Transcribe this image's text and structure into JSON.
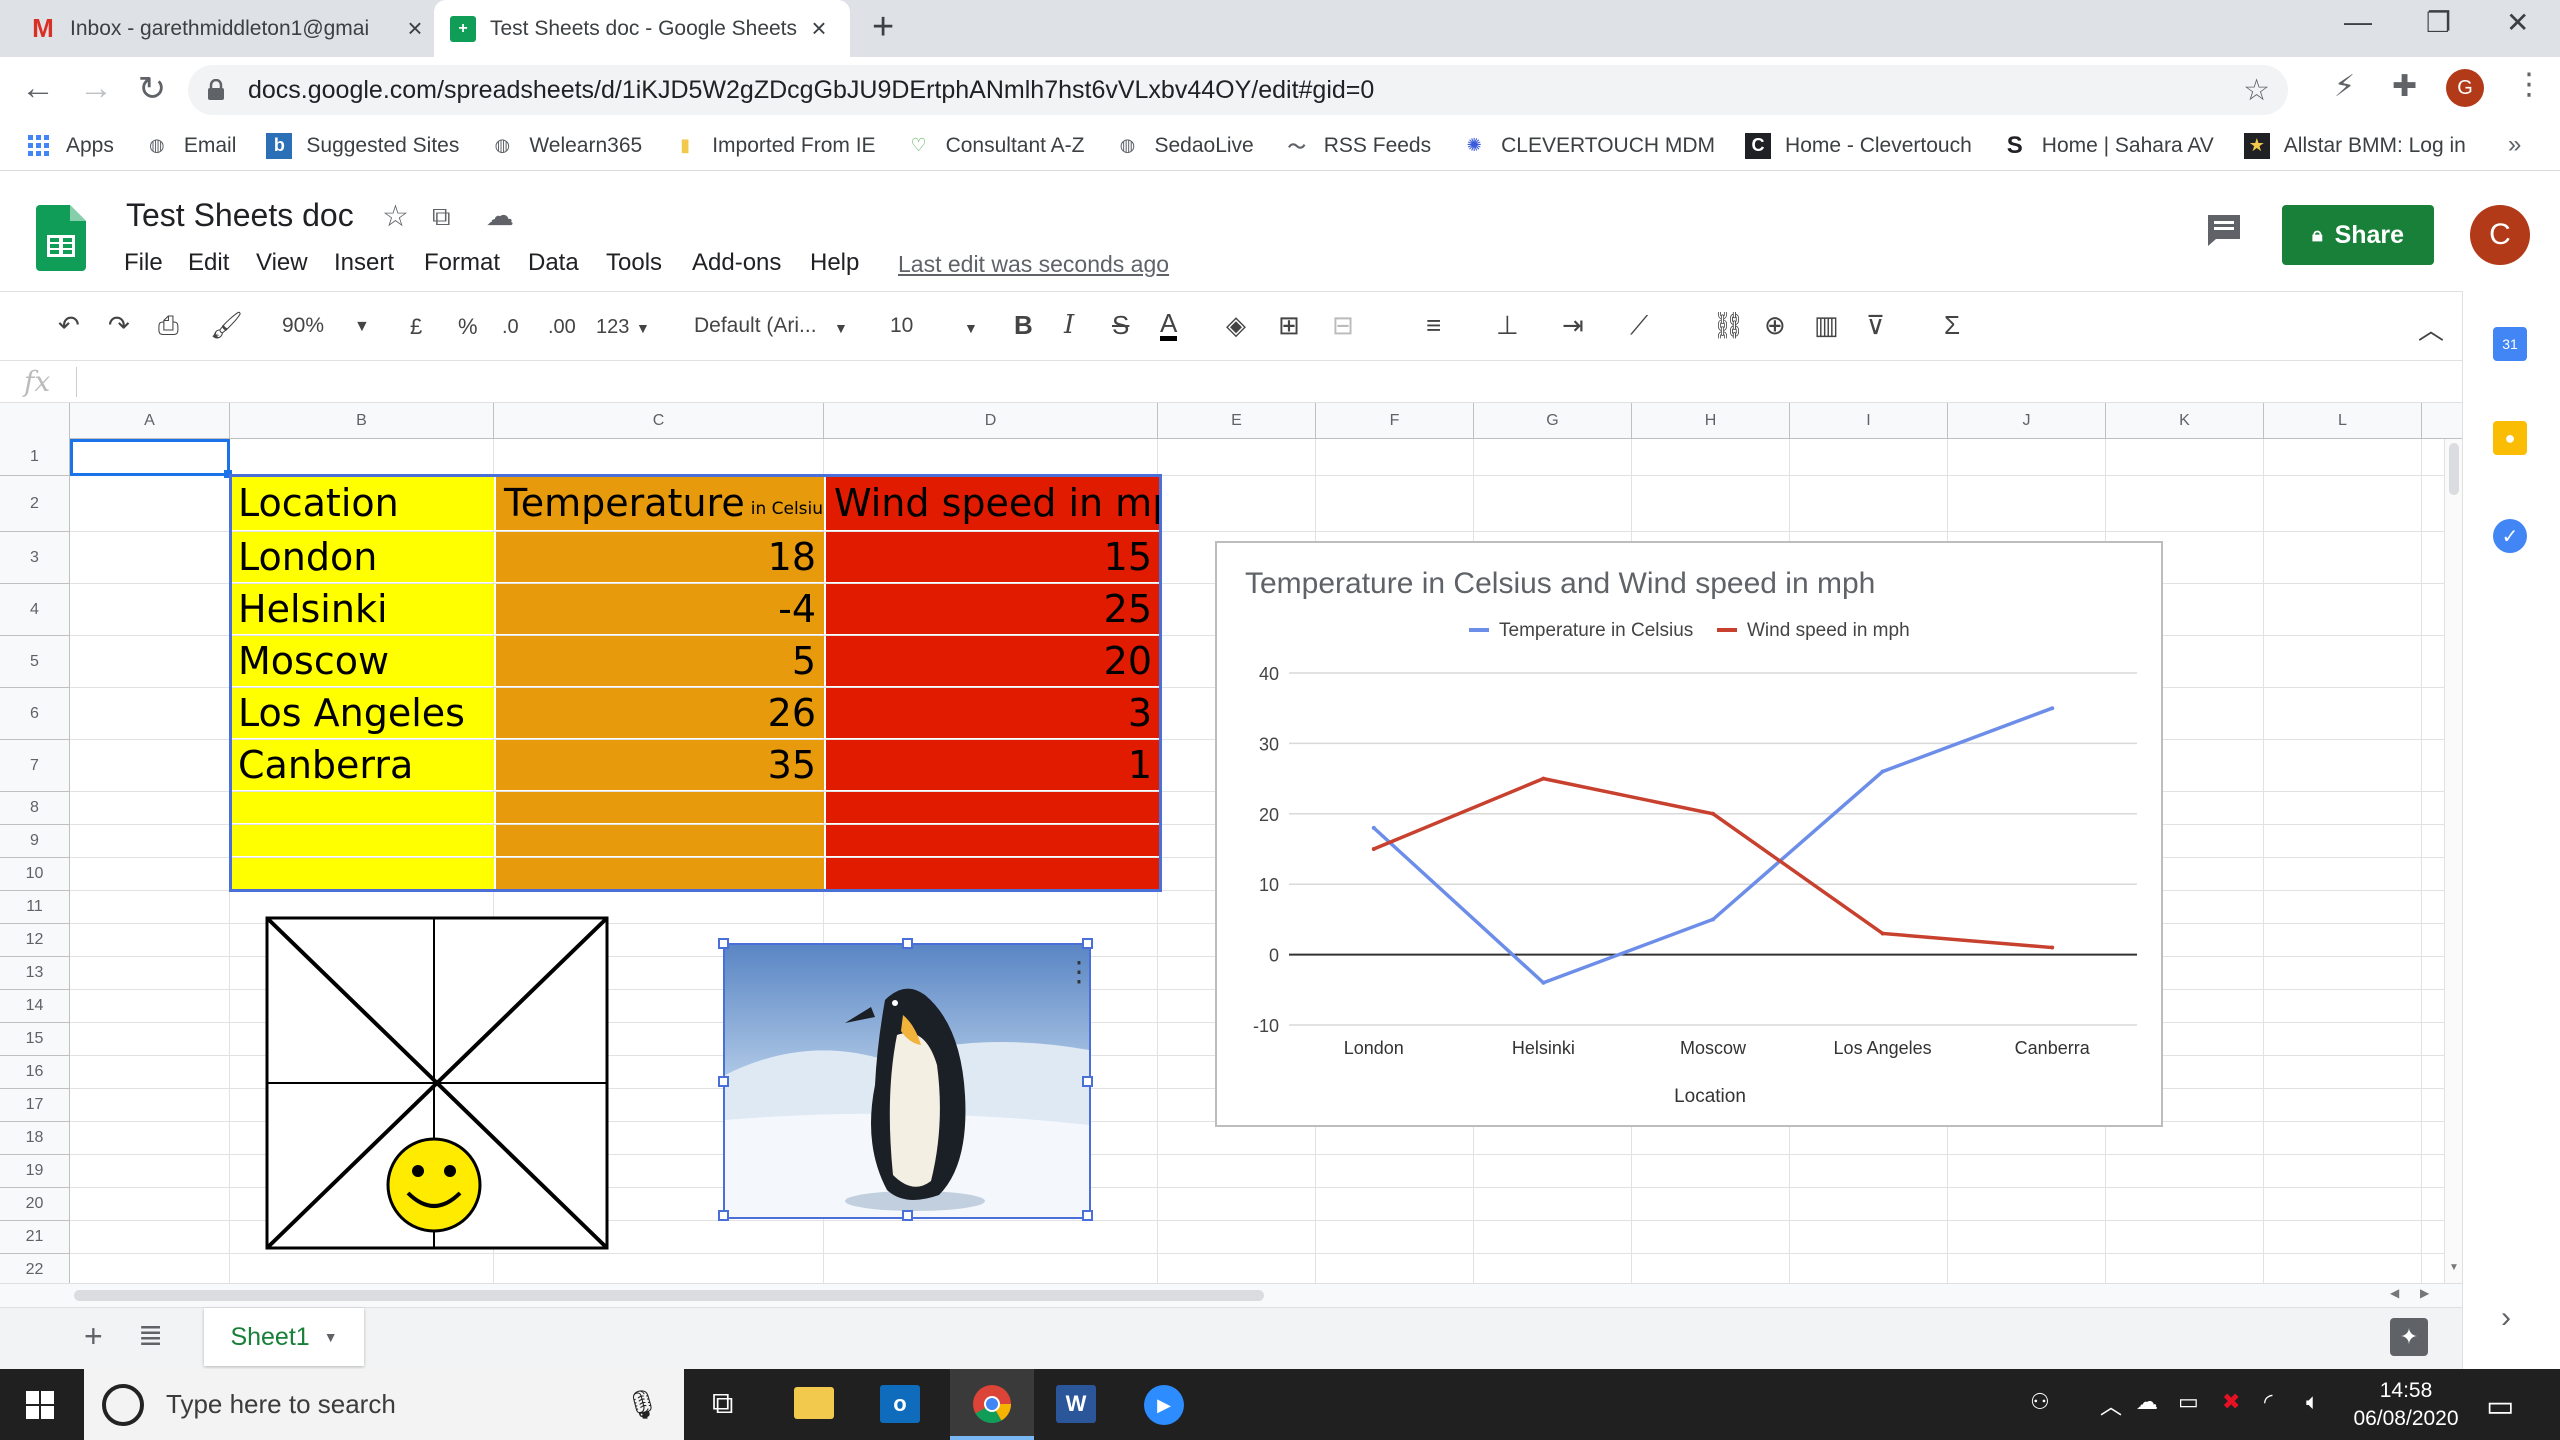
{
  "browser": {
    "tabs": [
      {
        "label": "Inbox - garethmiddleton1@gmai",
        "icon": "gmail-icon"
      },
      {
        "label": "Test Sheets doc - Google Sheets",
        "icon": "sheets-icon"
      }
    ],
    "url": "docs.google.com/spreadsheets/d/1iKJD5W2gZDcgGbJU9DErtphANmlh7hst6vVLxbv44OY/edit#gid=0",
    "profile_initial": "G",
    "bookmarks": [
      "Apps",
      "Email",
      "Suggested Sites",
      "Welearn365",
      "Imported From IE",
      "Consultant A-Z",
      "SedaoLive",
      "RSS Feeds",
      "CLEVERTOUCH MDM",
      "Home - Clevertouch",
      "Home | Sahara AV",
      "Allstar BMM: Log in"
    ]
  },
  "sheets": {
    "title": "Test Sheets doc",
    "menu": [
      "File",
      "Edit",
      "View",
      "Insert",
      "Format",
      "Data",
      "Tools",
      "Add-ons",
      "Help"
    ],
    "last_edit": "Last edit was seconds ago",
    "share_label": "Share",
    "user_initial": "C",
    "toolbar": {
      "zoom": "90%",
      "currency": "£",
      "percent": "%",
      "dec_less": ".0",
      "dec_more": ".00",
      "number_format": "123",
      "font": "Default (Ari...",
      "font_size": "10",
      "bold": "B",
      "italic": "I",
      "strike": "S",
      "text_color": "A",
      "functions": "Σ"
    },
    "formula_label": "fx",
    "columns": [
      "A",
      "B",
      "C",
      "D",
      "E",
      "F",
      "G",
      "H",
      "I",
      "J",
      "K",
      "L"
    ],
    "rows": [
      "1",
      "2",
      "3",
      "4",
      "5",
      "6",
      "7",
      "8",
      "9",
      "10",
      "11",
      "12",
      "13",
      "14",
      "15",
      "16",
      "17",
      "18",
      "19",
      "20",
      "21",
      "22"
    ],
    "table": {
      "headers": {
        "location": "Location",
        "temperature": "Temperature",
        "temperature_unit": "in Celsius",
        "wind": "Wind speed in mph"
      },
      "data": [
        {
          "location": "London",
          "temperature": "18",
          "wind": "15"
        },
        {
          "location": "Helsinki",
          "temperature": "-4",
          "wind": "25"
        },
        {
          "location": "Moscow",
          "temperature": "5",
          "wind": "20"
        },
        {
          "location": "Los Angeles",
          "temperature": "26",
          "wind": "3"
        },
        {
          "location": "Canberra",
          "temperature": "35",
          "wind": "1"
        }
      ]
    },
    "sheet_tab": "Sheet1"
  },
  "chart_data": {
    "type": "line",
    "title": "Temperature in Celsius and Wind speed in mph",
    "categories": [
      "London",
      "Helsinki",
      "Moscow",
      "Los Angeles",
      "Canberra"
    ],
    "series": [
      {
        "name": "Temperature in Celsius",
        "values": [
          18,
          -4,
          5,
          26,
          35
        ],
        "color": "#6d8ee8"
      },
      {
        "name": "Wind speed in mph",
        "values": [
          15,
          25,
          20,
          3,
          1
        ],
        "color": "#c8402e"
      }
    ],
    "xlabel": "Location",
    "ylabel": "",
    "ylim": [
      -10,
      40
    ],
    "yticks": [
      "40",
      "30",
      "20",
      "10",
      "0",
      "-10"
    ],
    "legend": "top",
    "grid": true
  },
  "taskbar": {
    "search_placeholder": "Type here to search",
    "time": "14:58",
    "date": "06/08/2020"
  }
}
